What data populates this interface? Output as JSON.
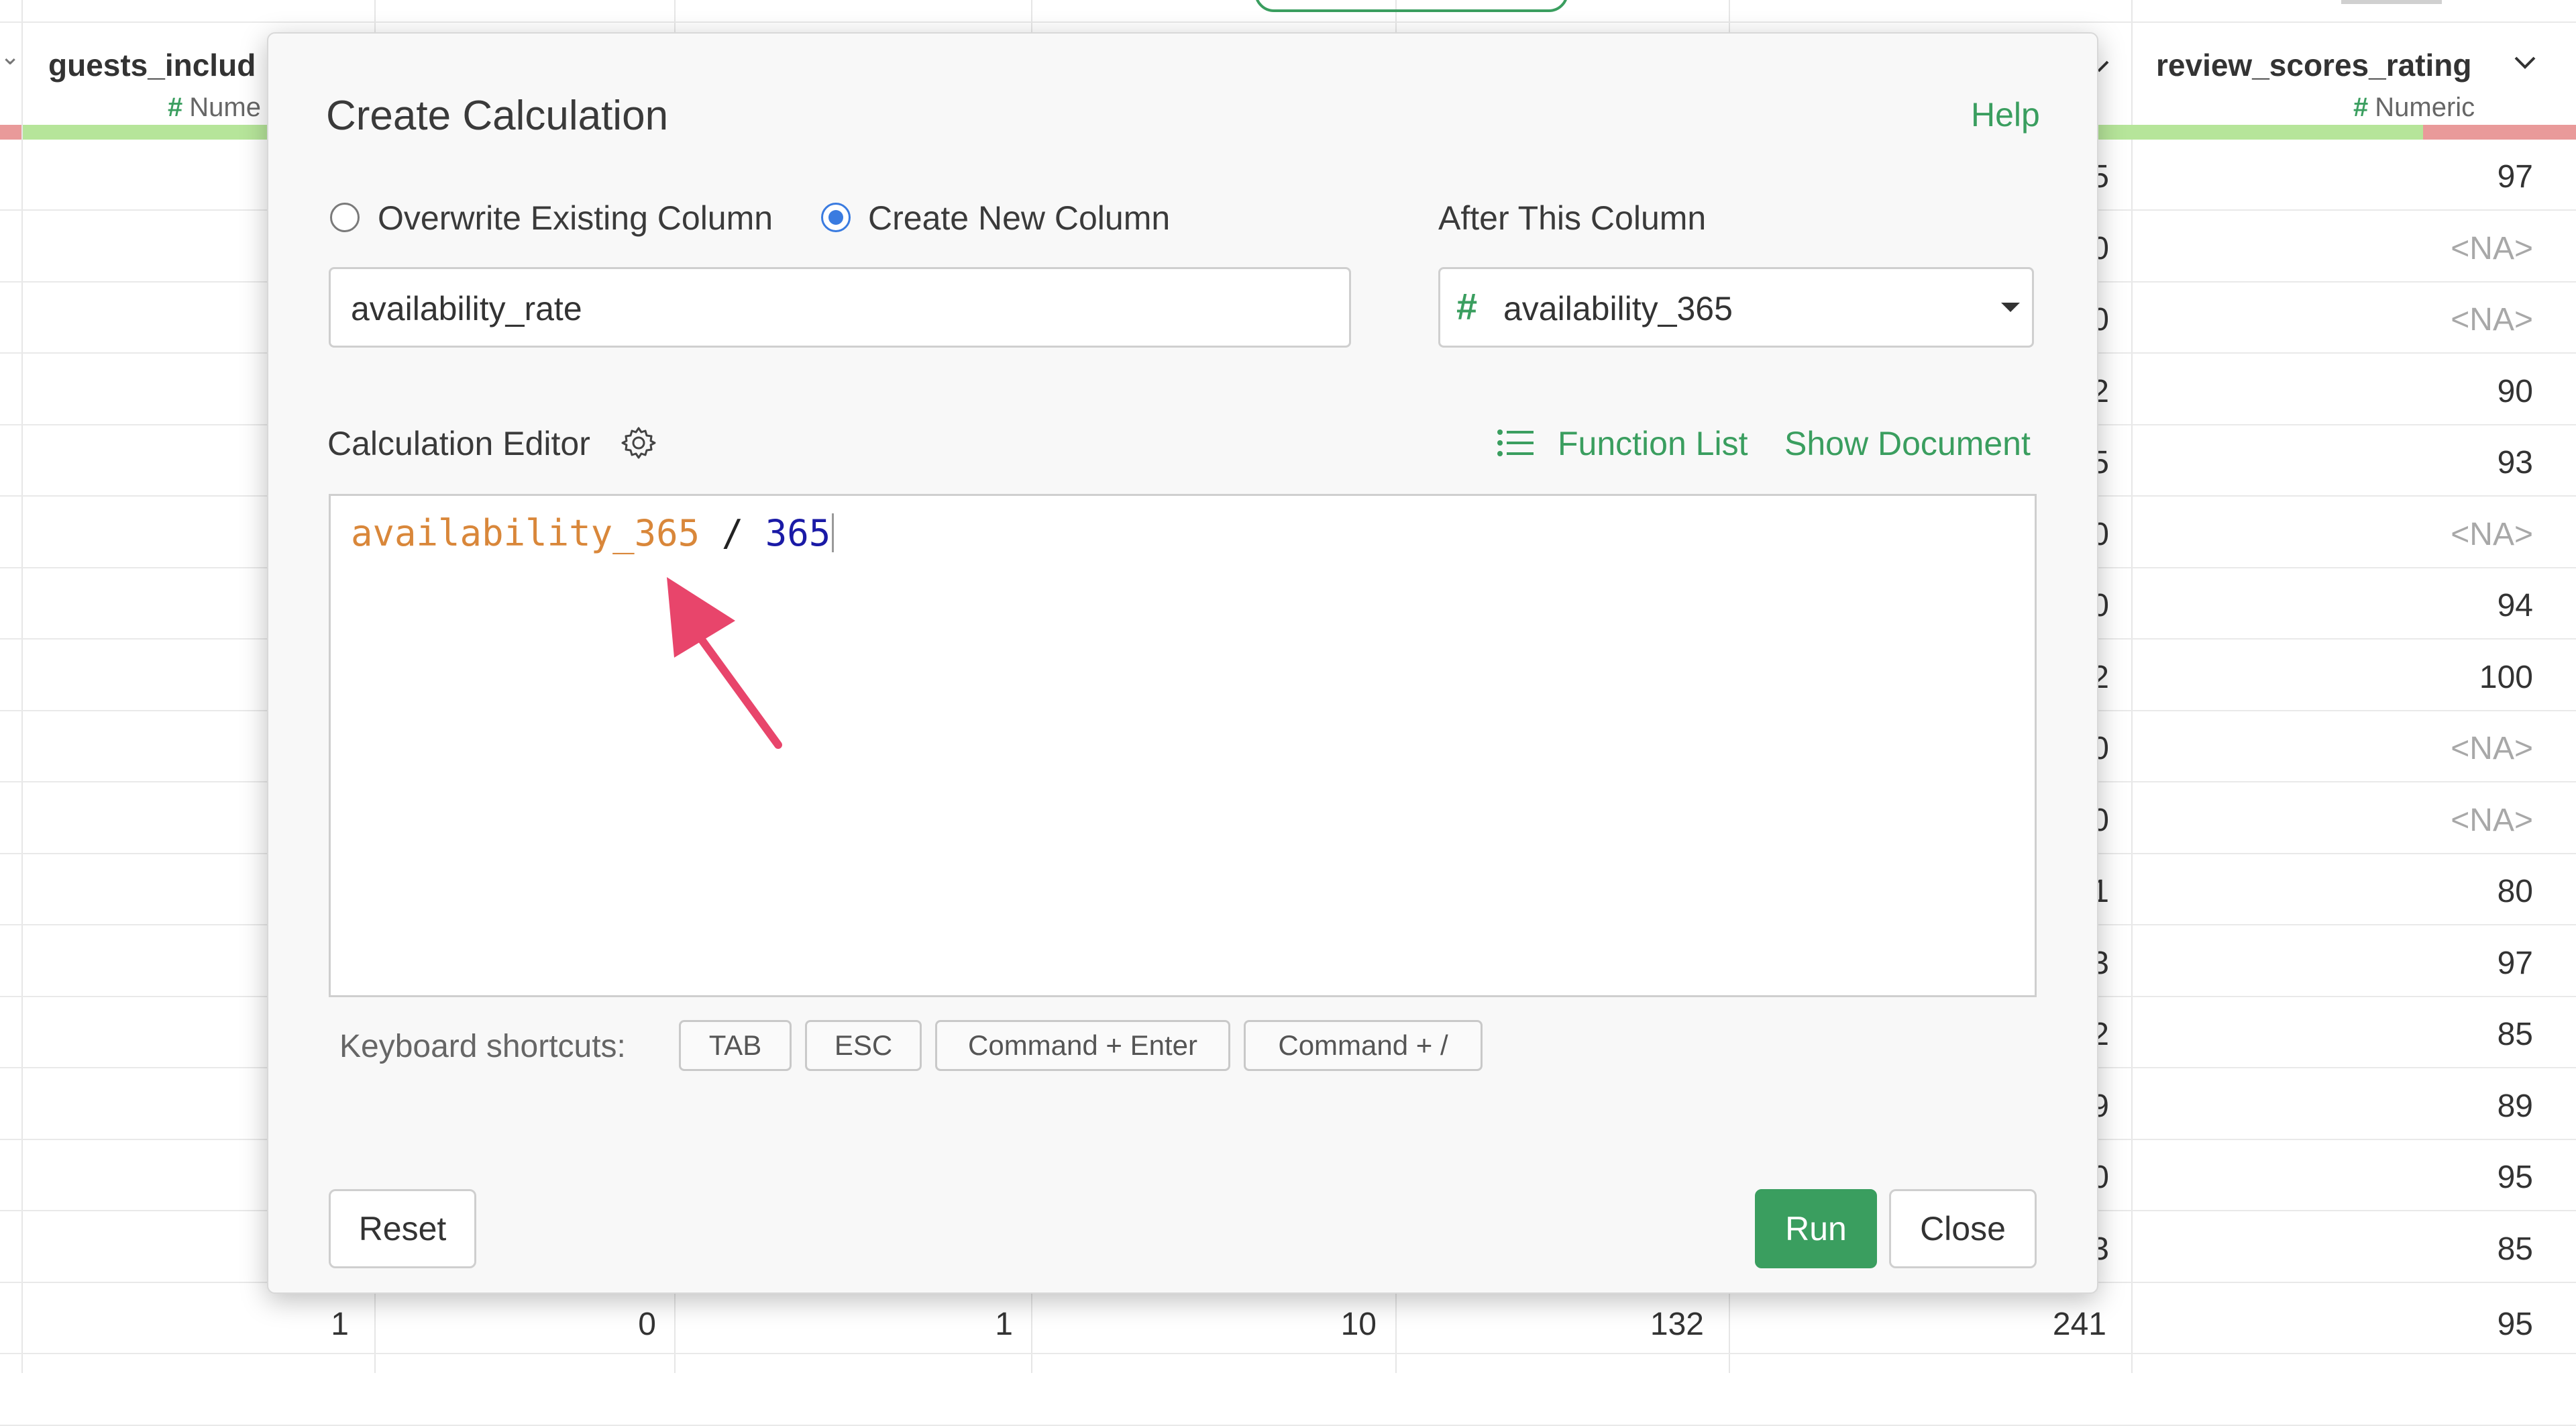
{
  "table": {
    "columns": [
      {
        "name": "guests_includ",
        "type_label": "Nume",
        "type_icon": "hash-icon"
      },
      {
        "name": "review_scores_rating",
        "type_label": "Numeric",
        "type_icon": "hash-icon"
      }
    ],
    "partial_col_glyphs": [
      "5",
      "0",
      "0",
      "2",
      "5",
      "0",
      "0",
      "2",
      "0",
      "0",
      "1",
      "3",
      "2",
      "9",
      "0",
      "3"
    ],
    "review_scores_rating": [
      "97",
      "<NA>",
      "<NA>",
      "90",
      "93",
      "<NA>",
      "94",
      "100",
      "<NA>",
      "<NA>",
      "80",
      "97",
      "85",
      "89",
      "95",
      "85"
    ],
    "last_row": [
      "1",
      "0",
      "1",
      "10",
      "132",
      "241",
      "95"
    ]
  },
  "dialog": {
    "title": "Create Calculation",
    "help": "Help",
    "radio_overwrite": "Overwrite Existing Column",
    "radio_create": "Create New Column",
    "selected_mode": "Create New Column",
    "after_label": "After This Column",
    "column_name_value": "availability_rate",
    "after_column_value": "availability_365",
    "editor_label": "Calculation Editor",
    "function_list": "Function List",
    "show_document": "Show Document",
    "code": {
      "column_ref": "availability_365",
      "operator": "/",
      "number": "365"
    },
    "shortcuts_label": "Keyboard shortcuts:",
    "shortcuts": [
      "TAB",
      "ESC",
      "Command + Enter",
      "Command + /"
    ],
    "reset": "Reset",
    "run": "Run",
    "close": "Close"
  },
  "colors": {
    "accent_green": "#3a9e5f",
    "radio_blue": "#3a7be0",
    "code_column": "#d9873a",
    "code_number": "#1a1aa6",
    "annotation_arrow": "#e8456b",
    "quality_good": "#b6e59a",
    "quality_missing": "#e99a9a"
  }
}
